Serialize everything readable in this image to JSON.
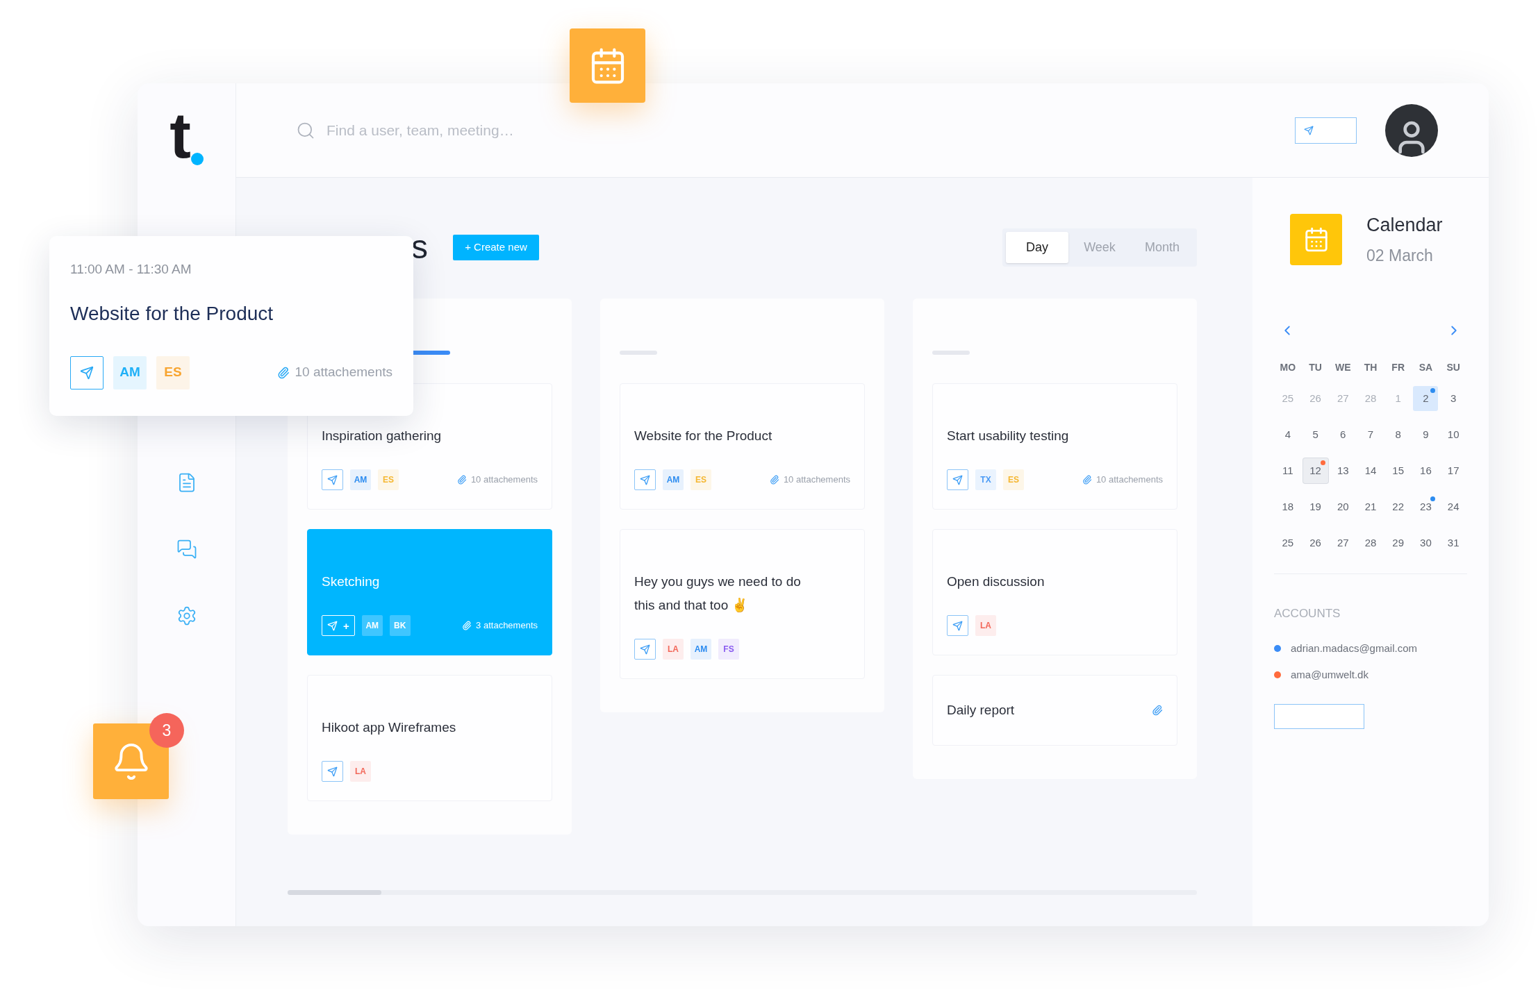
{
  "logo": "t",
  "search": {
    "placeholder": "Find a user, team, meeting…"
  },
  "page_title": "s",
  "create_button": "+ Create new",
  "view_tabs": [
    {
      "label": "Day",
      "selected": true
    },
    {
      "label": "Week",
      "selected": false
    },
    {
      "label": "Month",
      "selected": false
    }
  ],
  "columns": [
    {
      "selected": true,
      "cards": [
        {
          "kind": "task",
          "title": "Inspiration gathering",
          "highlighted": false,
          "chips": [
            {
              "label": "AM",
              "color": "#2d8cf0"
            },
            {
              "label": "ES",
              "color": "#f5b731"
            }
          ],
          "attachments": "10 attachements"
        },
        {
          "kind": "task",
          "title": "Sketching",
          "highlighted": true,
          "send_label": "+",
          "chips": [
            {
              "label": "AM",
              "color": "#3fc6ff"
            },
            {
              "label": "BK",
              "color": "#3fc6ff"
            }
          ],
          "attachments": "3 attachements"
        },
        {
          "kind": "task",
          "title": "Hikoot app Wireframes",
          "highlighted": false,
          "chips": [
            {
              "label": "LA",
              "color": "#f2685a"
            }
          ]
        }
      ]
    },
    {
      "selected": false,
      "cards": [
        {
          "kind": "task",
          "title": "Website for the Product",
          "highlighted": false,
          "chips": [
            {
              "label": "AM",
              "color": "#2d8cf0"
            },
            {
              "label": "ES",
              "color": "#f5b731"
            }
          ],
          "attachments": "10 attachements"
        },
        {
          "kind": "task",
          "title": "Hey you guys we need to do this and that too ✌️",
          "highlighted": false,
          "chips": [
            {
              "label": "LA",
              "color": "#f2685a"
            },
            {
              "label": "AM",
              "color": "#2d8cf0"
            },
            {
              "label": "FS",
              "color": "#8a5cf0"
            }
          ]
        }
      ]
    },
    {
      "selected": false,
      "cards": [
        {
          "kind": "task",
          "title": "Start usability testing",
          "highlighted": false,
          "chips": [
            {
              "label": "TX",
              "color": "#4a9af5"
            },
            {
              "label": "ES",
              "color": "#f5b731"
            }
          ],
          "attachments": "10 attachements"
        },
        {
          "kind": "task",
          "title": "Open discussion",
          "highlighted": false,
          "chips": [
            {
              "label": "LA",
              "color": "#f2685a"
            }
          ]
        },
        {
          "kind": "note",
          "title": "Daily report",
          "highlighted": false
        }
      ]
    }
  ],
  "calendar": {
    "title": "Calendar",
    "date": "02 March",
    "weekdays": [
      "MO",
      "TU",
      "WE",
      "TH",
      "FR",
      "SA",
      "SU"
    ],
    "days": [
      {
        "label": "25",
        "muted": true,
        "selected": false,
        "shaded": false
      },
      {
        "label": "26",
        "muted": true,
        "selected": false,
        "shaded": false
      },
      {
        "label": "27",
        "muted": true,
        "selected": false,
        "shaded": false
      },
      {
        "label": "28",
        "muted": true,
        "selected": false,
        "shaded": false
      },
      {
        "label": "1",
        "muted": true,
        "selected": false,
        "shaded": false
      },
      {
        "label": "2",
        "muted": false,
        "selected": true,
        "shaded": false,
        "color": "#2d8cf0"
      },
      {
        "label": "3",
        "muted": false,
        "selected": false,
        "shaded": false
      },
      {
        "label": "4",
        "muted": false,
        "selected": false,
        "shaded": false
      },
      {
        "label": "5",
        "muted": false,
        "selected": false,
        "shaded": false
      },
      {
        "label": "6",
        "muted": false,
        "selected": false,
        "shaded": false
      },
      {
        "label": "7",
        "muted": false,
        "selected": false,
        "shaded": false
      },
      {
        "label": "8",
        "muted": false,
        "selected": false,
        "shaded": false
      },
      {
        "label": "9",
        "muted": false,
        "selected": false,
        "shaded": false
      },
      {
        "label": "10",
        "muted": false,
        "selected": false,
        "shaded": false
      },
      {
        "label": "11",
        "muted": false,
        "selected": false,
        "shaded": false
      },
      {
        "label": "12",
        "muted": false,
        "selected": false,
        "shaded": true,
        "color": "#ff6b3d"
      },
      {
        "label": "13",
        "muted": false,
        "selected": false,
        "shaded": false
      },
      {
        "label": "14",
        "muted": false,
        "selected": false,
        "shaded": false
      },
      {
        "label": "15",
        "muted": false,
        "selected": false,
        "shaded": false
      },
      {
        "label": "16",
        "muted": false,
        "selected": false,
        "shaded": false
      },
      {
        "label": "17",
        "muted": false,
        "selected": false,
        "shaded": false
      },
      {
        "label": "18",
        "muted": false,
        "selected": false,
        "shaded": false
      },
      {
        "label": "19",
        "muted": false,
        "selected": false,
        "shaded": false
      },
      {
        "label": "20",
        "muted": false,
        "selected": false,
        "shaded": false
      },
      {
        "label": "21",
        "muted": false,
        "selected": false,
        "shaded": false
      },
      {
        "label": "22",
        "muted": false,
        "selected": false,
        "shaded": false
      },
      {
        "label": "23",
        "muted": false,
        "selected": false,
        "shaded": false,
        "color": "#2d8cf0"
      },
      {
        "label": "24",
        "muted": false,
        "selected": false,
        "shaded": false
      },
      {
        "label": "25",
        "muted": false,
        "selected": false,
        "shaded": false
      },
      {
        "label": "26",
        "muted": false,
        "selected": false,
        "shaded": false
      },
      {
        "label": "27",
        "muted": false,
        "selected": false,
        "shaded": false
      },
      {
        "label": "28",
        "muted": false,
        "selected": false,
        "shaded": false
      },
      {
        "label": "29",
        "muted": false,
        "selected": false,
        "shaded": false
      },
      {
        "label": "30",
        "muted": false,
        "selected": false,
        "shaded": false
      },
      {
        "label": "31",
        "muted": false,
        "selected": false,
        "shaded": false
      }
    ]
  },
  "accounts": {
    "heading": "ACCOUNTS",
    "items": [
      {
        "email": "adrian.madacs@gmail.com",
        "color": "#3b8cf6"
      },
      {
        "email": "ama@umwelt.dk",
        "color": "#ff6b3d"
      }
    ]
  },
  "popup": {
    "time": "11:00 AM - 11:30 AM",
    "title": "Website for the Product",
    "chips": [
      {
        "label": "AM",
        "color": "#1fb0f7"
      },
      {
        "label": "ES",
        "color": "#f7a531"
      }
    ],
    "attachments": "10 attachements"
  },
  "notifications": {
    "count": "3"
  }
}
